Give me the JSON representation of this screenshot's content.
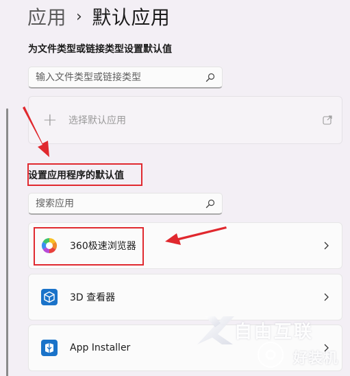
{
  "breadcrumb": {
    "parent": "应用",
    "separator": "›",
    "current": "默认应用"
  },
  "file_type_section": {
    "label": "为文件类型或链接类型设置默认值",
    "search_placeholder": "输入文件类型或链接类型",
    "choose_default_label": "选择默认应用"
  },
  "apps_section": {
    "label": "设置应用程序的默认值",
    "search_placeholder": "搜索应用",
    "apps": [
      {
        "name": "360极速浏览器",
        "icon": "360-browser-icon"
      },
      {
        "name": "3D 查看器",
        "icon": "3d-viewer-icon"
      },
      {
        "name": "App Installer",
        "icon": "app-installer-icon"
      }
    ]
  },
  "watermark": {
    "line1": "自由互联",
    "line2": "好装机"
  },
  "colors": {
    "annotation_red": "#e0282e",
    "accent_blue": "#1a73c9"
  }
}
